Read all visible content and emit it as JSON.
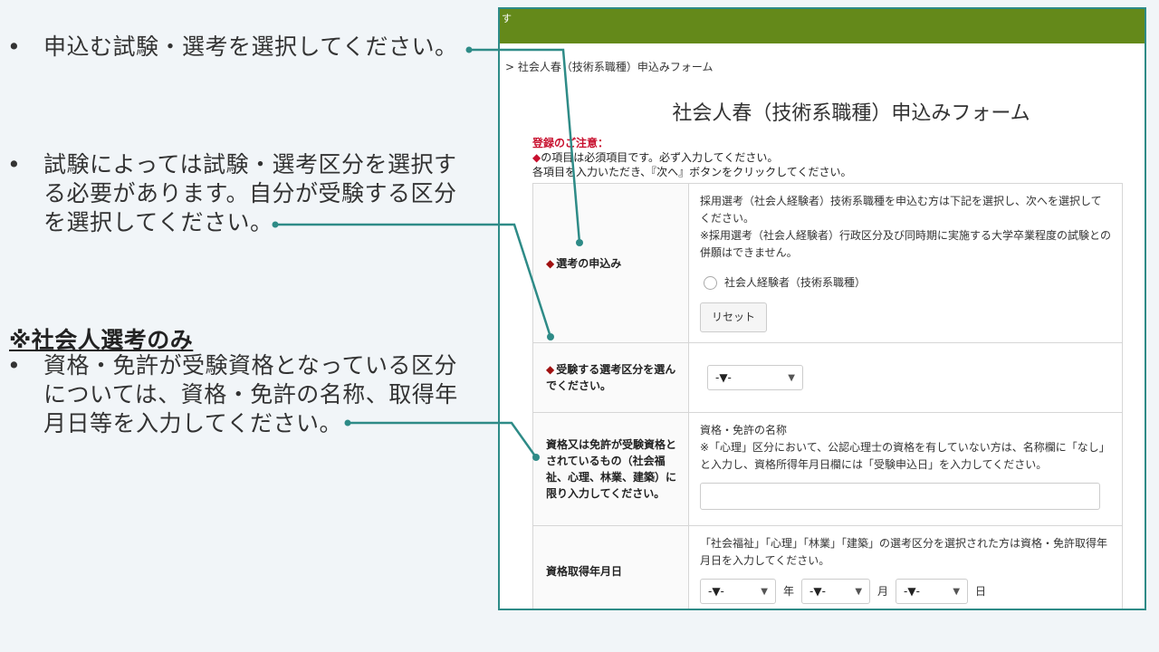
{
  "left_panel": {
    "bullet_glyph": "•",
    "bullet1": "申込む試験・選考を選択してください。",
    "bullet2_lines": [
      "試験によっては試験・選考区分を選択す",
      "る必要があります。自分が受験する区分",
      "を選択してください。"
    ],
    "social_note": "※社会人選考のみ",
    "bullet3_lines": [
      "資格・免許が受験資格となっている区分",
      "については、資格・免許の名称、取得年",
      "月日等を入力してください。"
    ]
  },
  "screenshot": {
    "topbar_text": "す",
    "breadcrumb": "> 社会人春（技術系職種）申込みフォーム",
    "title": "社会人春（技術系職種）申込みフォーム",
    "notice": {
      "heading": "登録のご注意：",
      "required_mark": "◆",
      "required_text": "の項目は必須項目です。必ず入力してください。",
      "next_text": "各項目を入力いただき、『次へ』ボタンをクリックしてください。"
    },
    "rows": {
      "apply": {
        "mark": "◆",
        "label": "選考の申込み",
        "desc1": "採用選考（社会人経験者）技術系職種を申込む方は下記を選択し、次へを選択してください。",
        "desc2": "※採用選考（社会人経験者）行政区分及び同時期に実施する大学卒業程度の試験との併願はできません。",
        "radio_label": "社会人経験者（技術系職種）",
        "reset_label": "リセット"
      },
      "category": {
        "mark": "◆",
        "label": "受験する選考区分を選んでください。",
        "select_value": "-▼-"
      },
      "license": {
        "label": "資格又は免許が受験資格とされているもの（社会福祉、心理、林業、建築）に限り入力してください。",
        "field_title": "資格・免許の名称",
        "desc": "※「心理」区分において、公認心理士の資格を有していない方は、名称欄に「なし」と入力し、資格所得年月日欄には「受験申込日」を入力してください。",
        "input_value": ""
      },
      "date": {
        "label": "資格取得年月日",
        "desc": "「社会福祉」「心理」「林業」「建築」の選考区分を選択された方は資格・免許取得年月日を入力してください。",
        "year_value": "-▼-",
        "year_unit": "年",
        "month_value": "-▼-",
        "month_unit": "月",
        "day_value": "-▼-",
        "day_unit": "日"
      }
    }
  },
  "colors": {
    "topbar": "#64891a",
    "frame_border": "#2e8b87",
    "connector": "#2e8b87",
    "required_red": "#c8102e"
  }
}
